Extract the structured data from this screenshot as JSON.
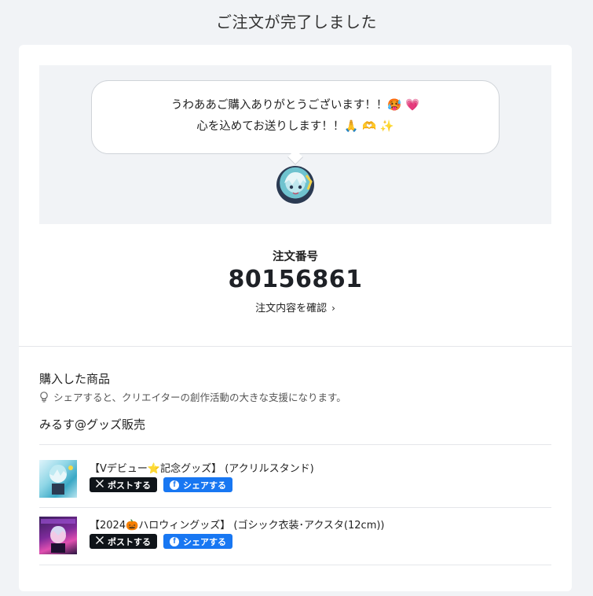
{
  "page": {
    "title": "ご注文が完了しました"
  },
  "message": {
    "line1": "うわああご購入ありがとうございます！！🥵 💗",
    "line2": "心を込めてお送りします！！🙏 🫶 ✨"
  },
  "order": {
    "label": "注文番号",
    "number": "80156861",
    "link_label": "注文内容を確認"
  },
  "purchased": {
    "title": "購入した商品",
    "hint": "シェアすると、クリエイターの創作活動の大きな支援になります。",
    "shop": "みるす@グッズ販売",
    "items": [
      {
        "name": "【Vデビュー⭐記念グッズ】 (アクリルスタンド)",
        "x_label": "ポストする",
        "fb_label": "シェアする"
      },
      {
        "name": "【2024🎃ハロウィングッズ】 (ゴシック衣装･アクスタ(12cm))",
        "x_label": "ポストする",
        "fb_label": "シェアする"
      }
    ]
  },
  "colors": {
    "background": "#f1f3f6",
    "x_button": "#0f1419",
    "facebook_button": "#1877f2"
  }
}
